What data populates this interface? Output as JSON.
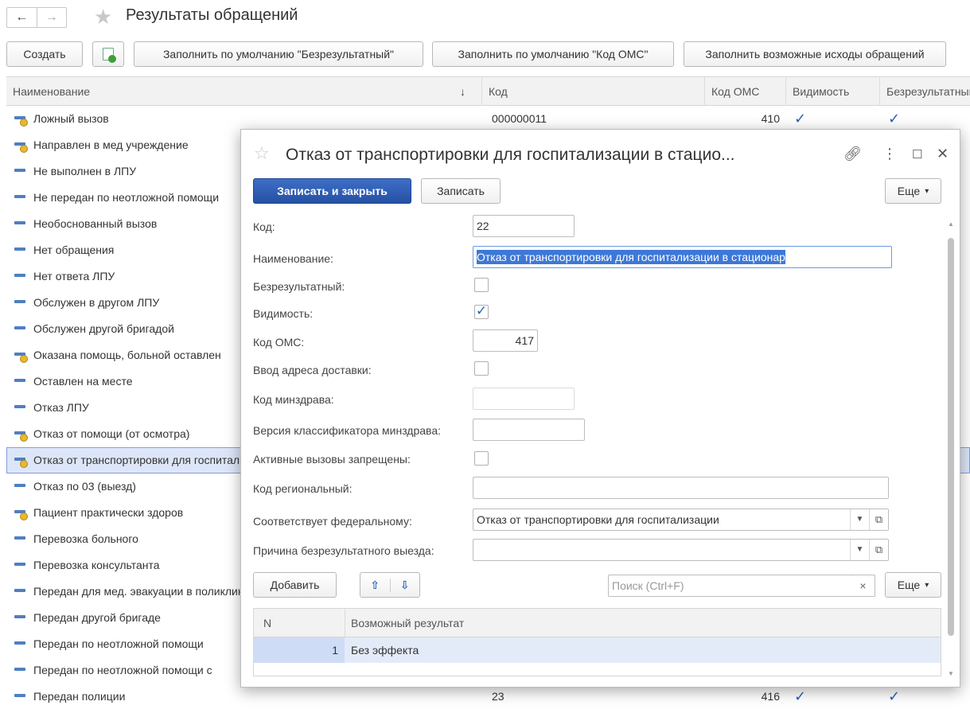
{
  "window": {
    "title": "Результаты обращений",
    "nav_back": "←",
    "nav_forward": "→",
    "star": "★"
  },
  "toolbar": {
    "create_label": "Создать",
    "fill_noresult_label": "Заполнить по умолчанию \"Безрезультатный\"",
    "fill_oms_label": "Заполнить по умолчанию \"Код ОМС\"",
    "fill_outcomes_label": "Заполнить возможные исходы обращений"
  },
  "table": {
    "columns": [
      "Наименование",
      "Код",
      "Код ОМС",
      "Видимость",
      "Безрезультатный"
    ],
    "sort_indicator": "↓",
    "rows": [
      {
        "name": "Ложный вызов",
        "code": "000000011",
        "oms": "410",
        "visible": "✓",
        "noresult": "✓",
        "marked": true
      },
      {
        "name": "Направлен в мед учреждение",
        "code": "",
        "oms": "",
        "visible": "",
        "noresult": "",
        "marked": true
      },
      {
        "name": "Не выполнен в ЛПУ",
        "code": "",
        "oms": "",
        "visible": "",
        "noresult": "",
        "marked": false
      },
      {
        "name": "Не передан по неотложной помощи",
        "code": "",
        "oms": "",
        "visible": "",
        "noresult": "",
        "marked": false
      },
      {
        "name": "Необоснованный вызов",
        "code": "",
        "oms": "",
        "visible": "",
        "noresult": "",
        "marked": false
      },
      {
        "name": "Нет обращения",
        "code": "",
        "oms": "",
        "visible": "",
        "noresult": "",
        "marked": false
      },
      {
        "name": "Нет ответа ЛПУ",
        "code": "",
        "oms": "",
        "visible": "",
        "noresult": "",
        "marked": false
      },
      {
        "name": "Обслужен в другом ЛПУ",
        "code": "",
        "oms": "",
        "visible": "",
        "noresult": "",
        "marked": false
      },
      {
        "name": "Обслужен другой бригадой",
        "code": "",
        "oms": "",
        "visible": "",
        "noresult": "",
        "marked": false
      },
      {
        "name": "Оказана помощь, больной оставлен",
        "code": "",
        "oms": "",
        "visible": "",
        "noresult": "",
        "marked": true
      },
      {
        "name": "Оставлен на месте",
        "code": "",
        "oms": "",
        "visible": "",
        "noresult": "",
        "marked": false
      },
      {
        "name": "Отказ ЛПУ",
        "code": "",
        "oms": "",
        "visible": "",
        "noresult": "",
        "marked": false
      },
      {
        "name": "Отказ от помощи (от осмотра)",
        "code": "",
        "oms": "",
        "visible": "",
        "noresult": "",
        "marked": true
      },
      {
        "name": "Отказ от транспортировки для госпитализации",
        "code": "",
        "oms": "",
        "visible": "",
        "noresult": "",
        "marked": true,
        "selected": true
      },
      {
        "name": "Отказ по 03 (выезд)",
        "code": "",
        "oms": "",
        "visible": "",
        "noresult": "",
        "marked": false
      },
      {
        "name": "Пациент практически здоров",
        "code": "",
        "oms": "",
        "visible": "",
        "noresult": "",
        "marked": true
      },
      {
        "name": "Перевозка больного",
        "code": "",
        "oms": "",
        "visible": "",
        "noresult": "",
        "marked": false
      },
      {
        "name": "Перевозка консультанта",
        "code": "",
        "oms": "",
        "visible": "",
        "noresult": "",
        "marked": false
      },
      {
        "name": "Передан для мед. эвакуации в поликлинику",
        "code": "",
        "oms": "",
        "visible": "",
        "noresult": "",
        "marked": false
      },
      {
        "name": "Передан другой бригаде",
        "code": "",
        "oms": "",
        "visible": "",
        "noresult": "",
        "marked": false
      },
      {
        "name": "Передан по неотложной помощи",
        "code": "",
        "oms": "",
        "visible": "",
        "noresult": "",
        "marked": false
      },
      {
        "name": "Передан по неотложной помощи с",
        "code": "",
        "oms": "",
        "visible": "",
        "noresult": "",
        "marked": false
      },
      {
        "name": "Передан полиции",
        "code": "23",
        "oms": "416",
        "visible": "✓",
        "noresult": "✓",
        "marked": false
      }
    ]
  },
  "dialog": {
    "title": "Отказ от транспортировки для госпитализации в стацио...",
    "save_close_label": "Записать и закрыть",
    "save_label": "Записать",
    "more_label": "Еще",
    "fields": {
      "code_label": "Код:",
      "code_value": "22",
      "name_label": "Наименование:",
      "name_value": "Отказ от транспортировки для госпитализации в стационар",
      "noresult_label": "Безрезультатный:",
      "noresult_checked": false,
      "visible_label": "Видимость:",
      "visible_checked": true,
      "oms_label": "Код ОМС:",
      "oms_value": "417",
      "delivery_label": "Ввод адреса доставки:",
      "delivery_checked": false,
      "minzdrav_label": "Код минздрава:",
      "minzdrav_value": "",
      "classifier_label": "Версия классификатора минздрава:",
      "classifier_value": "",
      "active_label": "Активные вызовы запрещены:",
      "active_checked": false,
      "regional_label": "Код региональный:",
      "regional_value": "",
      "federal_label": "Соответствует федеральному:",
      "federal_value": "Отказ от транспортировки для госпитализации",
      "reason_label": "Причина безрезультатного выезда:",
      "reason_value": ""
    },
    "subtable": {
      "add_label": "Добавить",
      "search_placeholder": "Поиск (Ctrl+F)",
      "more_label": "Еще",
      "columns": [
        "N",
        "Возможный результат"
      ],
      "rows": [
        {
          "n": "1",
          "result": "Без эффекта"
        }
      ]
    }
  },
  "colors": {
    "accent": "#2a62b8",
    "primary_button": "#2e5cb0",
    "selection": "#dde6f8"
  }
}
